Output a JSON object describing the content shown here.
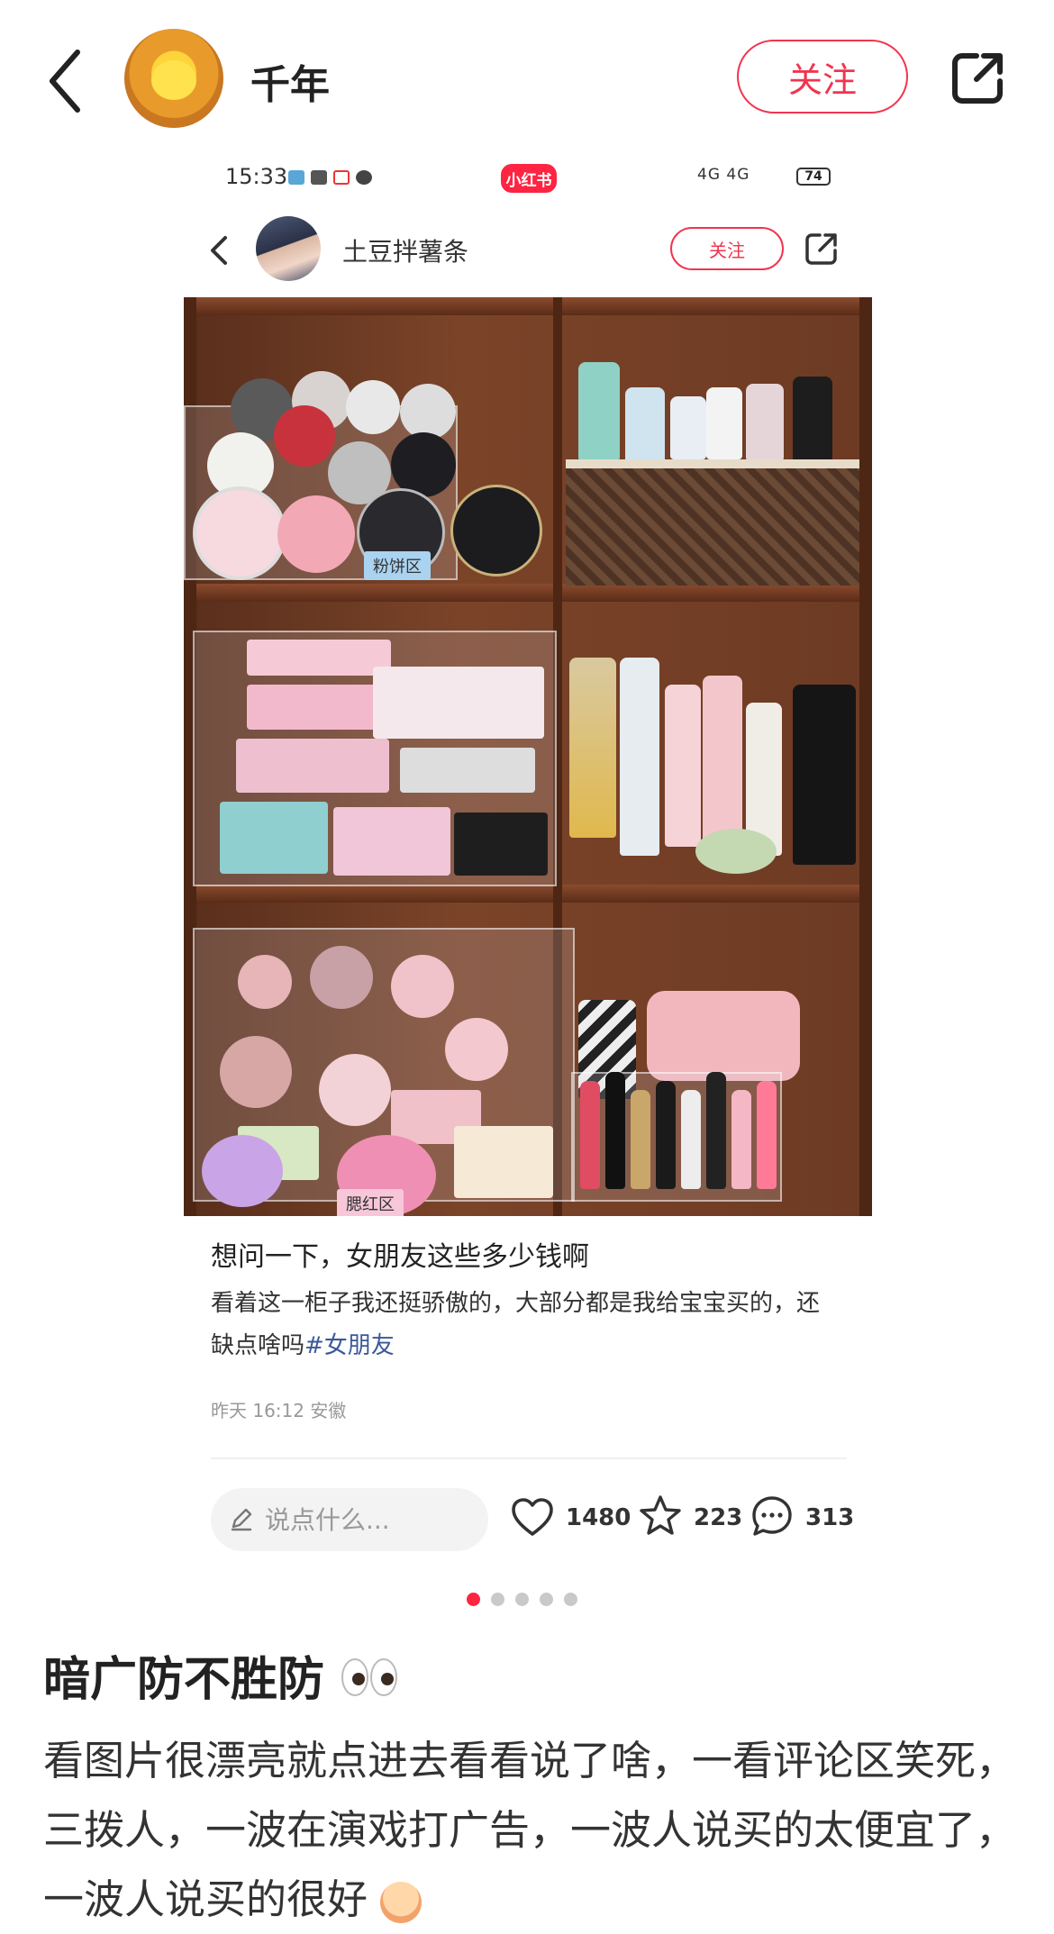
{
  "header": {
    "username": "千年",
    "follow_label": "关注"
  },
  "inner_post": {
    "status_time": "15:33",
    "app_badge": "小红书",
    "status_right": "4G 4G",
    "battery": "74",
    "author": "土豆拌薯条",
    "follow_label": "关注",
    "photo_labels": [
      "粉饼区",
      "腮红区"
    ],
    "title": "想问一下，女朋友这些多少钱啊",
    "body": "看着这一柜子我还挺骄傲的，大部分都是我给宝宝买的，还缺点啥吗",
    "tag": "#女朋友",
    "meta": "昨天 16:12 安徽",
    "comment_placeholder": "说点什么...",
    "likes": "1480",
    "stars": "223",
    "comments": "313"
  },
  "pagination": {
    "total": 5,
    "active": 0
  },
  "post": {
    "title": "暗广防不胜防",
    "body": "看图片很漂亮就点进去看看说了啥，一看评论区笑死，三拨人，一波在演戏打广告，一波人说买的太便宜了，一波人说买的很好"
  },
  "colors": {
    "accent": "#ff2442",
    "follow": "#f0354f"
  },
  "icons": [
    "back-icon",
    "share-icon",
    "heart-icon",
    "star-icon",
    "comment-icon",
    "pencil-icon",
    "eyes-emoji",
    "crying-emoji"
  ]
}
